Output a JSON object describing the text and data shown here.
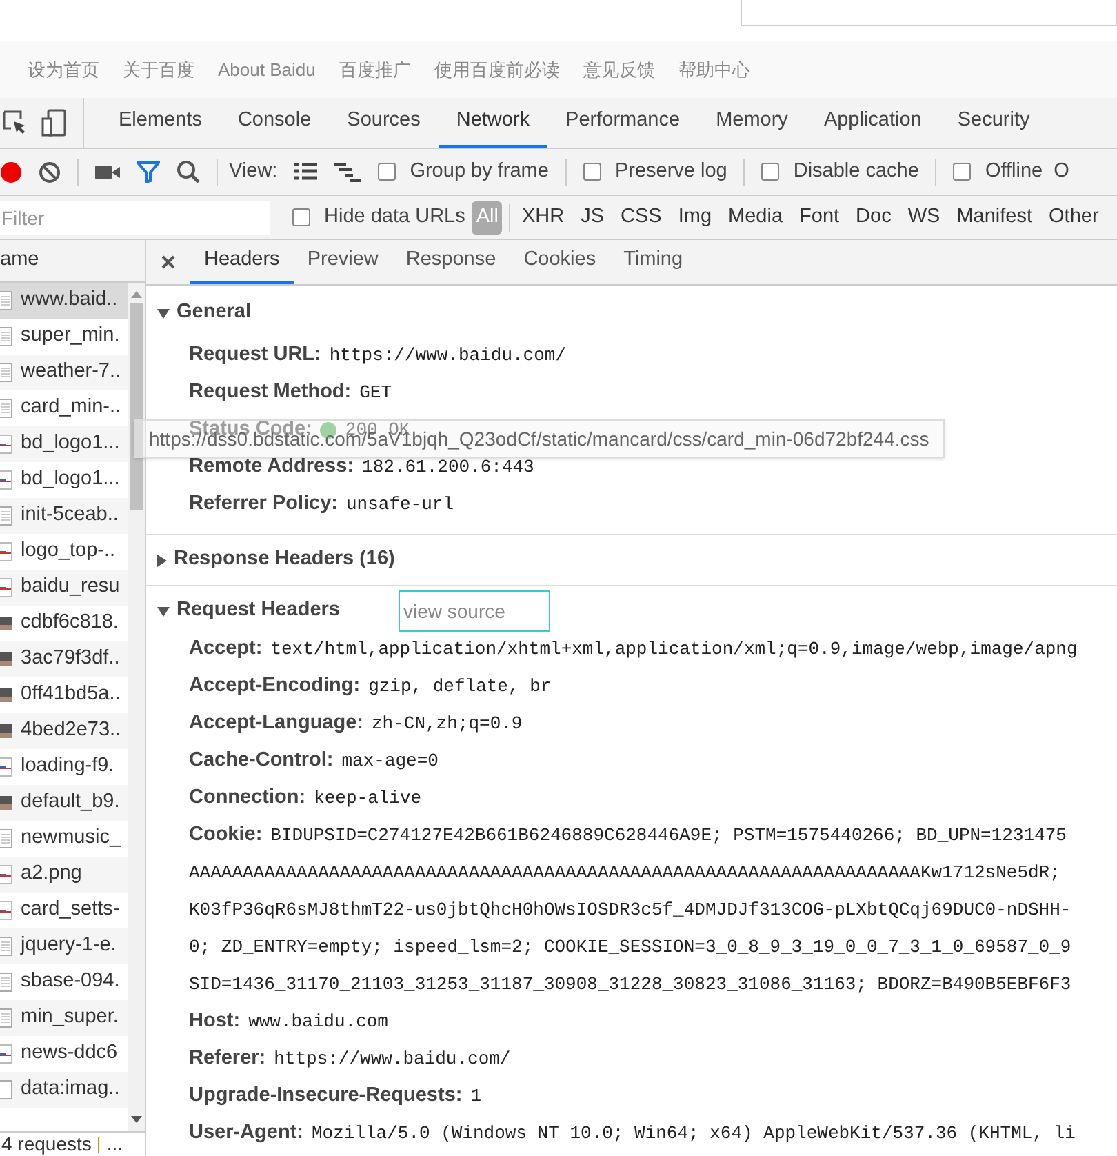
{
  "page_links": [
    "设为首页",
    "关于百度",
    "About Baidu",
    "百度推广",
    "使用百度前必读",
    "意见反馈",
    "帮助中心"
  ],
  "devtools_tabs": [
    {
      "label": "Elements",
      "selected": false
    },
    {
      "label": "Console",
      "selected": false
    },
    {
      "label": "Sources",
      "selected": false
    },
    {
      "label": "Network",
      "selected": true
    },
    {
      "label": "Performance",
      "selected": false
    },
    {
      "label": "Memory",
      "selected": false
    },
    {
      "label": "Application",
      "selected": false
    },
    {
      "label": "Security",
      "selected": false
    }
  ],
  "toolbar": {
    "recording": true,
    "filter_active": true,
    "view_label": "View:",
    "options": [
      {
        "label": "Group by frame",
        "checked": false
      },
      {
        "label": "Preserve log",
        "checked": false
      },
      {
        "label": "Disable cache",
        "checked": false
      },
      {
        "label": "Offline",
        "checked": false
      }
    ],
    "cut_label": "O"
  },
  "filter_bar": {
    "placeholder": "Filter",
    "hide_data_urls": {
      "label": "Hide data URLs",
      "checked": false
    },
    "types": [
      {
        "label": "All",
        "selected": true
      },
      {
        "label": "XHR",
        "selected": false
      },
      {
        "label": "JS",
        "selected": false
      },
      {
        "label": "CSS",
        "selected": false
      },
      {
        "label": "Img",
        "selected": false
      },
      {
        "label": "Media",
        "selected": false
      },
      {
        "label": "Font",
        "selected": false
      },
      {
        "label": "Doc",
        "selected": false
      },
      {
        "label": "WS",
        "selected": false
      },
      {
        "label": "Manifest",
        "selected": false
      },
      {
        "label": "Other",
        "selected": false
      }
    ]
  },
  "requests": {
    "column": "ame",
    "items": [
      {
        "name": "www.baid..",
        "kind": "doc",
        "selected": true
      },
      {
        "name": "super_min.",
        "kind": "doc",
        "selected": false
      },
      {
        "name": "weather-7..",
        "kind": "doc",
        "selected": false
      },
      {
        "name": "card_min-..",
        "kind": "doc",
        "selected": false
      },
      {
        "name": "bd_logo1...",
        "kind": "image",
        "selected": false
      },
      {
        "name": "bd_logo1...",
        "kind": "image",
        "selected": false
      },
      {
        "name": "init-5ceab..",
        "kind": "doc",
        "selected": false
      },
      {
        "name": "logo_top-..",
        "kind": "image",
        "selected": false
      },
      {
        "name": "baidu_resu",
        "kind": "image",
        "selected": false
      },
      {
        "name": "cdbf6c818.",
        "kind": "photo",
        "selected": false
      },
      {
        "name": "3ac79f3df..",
        "kind": "photo",
        "selected": false
      },
      {
        "name": "0ff41bd5a..",
        "kind": "photo",
        "selected": false
      },
      {
        "name": "4bed2e73..",
        "kind": "photo",
        "selected": false
      },
      {
        "name": "loading-f9.",
        "kind": "image",
        "selected": false
      },
      {
        "name": "default_b9.",
        "kind": "photo",
        "selected": false
      },
      {
        "name": "newmusic_",
        "kind": "doc",
        "selected": false
      },
      {
        "name": "a2.png",
        "kind": "image",
        "selected": false
      },
      {
        "name": "card_setts-",
        "kind": "image",
        "selected": false
      },
      {
        "name": "jquery-1-e.",
        "kind": "doc",
        "selected": false
      },
      {
        "name": "sbase-094.",
        "kind": "doc",
        "selected": false
      },
      {
        "name": "min_super.",
        "kind": "doc",
        "selected": false
      },
      {
        "name": "news-ddc6",
        "kind": "image",
        "selected": false
      },
      {
        "name": "data:imag..",
        "kind": "blank",
        "selected": false
      }
    ],
    "status": "4 requests",
    "status_more": "..."
  },
  "detail_tabs": [
    {
      "label": "Headers",
      "selected": true
    },
    {
      "label": "Preview",
      "selected": false
    },
    {
      "label": "Response",
      "selected": false
    },
    {
      "label": "Cookies",
      "selected": false
    },
    {
      "label": "Timing",
      "selected": false
    }
  ],
  "sections": [
    {
      "title": "General",
      "expanded": true,
      "rows": [
        {
          "name": "Request URL:",
          "value": "https://www.baidu.com/"
        },
        {
          "name": "Request Method:",
          "value": "GET"
        },
        {
          "name": "Status Code:",
          "value": "200 OK",
          "indicator": true
        },
        {
          "name": "Remote Address:",
          "value": "182.61.200.6:443"
        },
        {
          "name": "Referrer Policy:",
          "value": "unsafe-url"
        }
      ]
    },
    {
      "title": "Response Headers (16)",
      "expanded": false
    },
    {
      "title": "Request Headers",
      "expanded": true,
      "link": "view source",
      "rows": [
        {
          "name": "Accept:",
          "value": "text/html,application/xhtml+xml,application/xml;q=0.9,image/webp,image/apng"
        },
        {
          "name": "Accept-Encoding:",
          "value": "gzip, deflate, br"
        },
        {
          "name": "Accept-Language:",
          "value": "zh-CN,zh;q=0.9"
        },
        {
          "name": "Cache-Control:",
          "value": "max-age=0"
        },
        {
          "name": "Connection:",
          "value": "keep-alive"
        },
        {
          "name": "Cookie:",
          "value": "BIDUPSID=C274127E42B661B6246889C628446A9E; PSTM=1575440266; BD_UPN=1231475",
          "more": [
            "AAAAAAAAAAAAAAAAAAAAAAAAAAAAAAAAAAAAAAAAAAAAAAAAAAAAAAAAAAAAAAAAAAAAKw1712sNe5dR;",
            "K03fP36qR6sMJ8thmT22-us0jbtQhcH0hOWsIOSDR3c5f_4DMJDJf313COG-pLXbtQCqj69DUC0-nDSHH-",
            "0; ZD_ENTRY=empty; ispeed_lsm=2; COOKIE_SESSION=3_0_8_9_3_19_0_0_7_3_1_0_69587_0_9",
            "SID=1436_31170_21103_31253_31187_30908_31228_30823_31086_31163; BDORZ=B490B5EBF6F3"
          ]
        },
        {
          "name": "Host:",
          "value": "www.baidu.com"
        },
        {
          "name": "Referer:",
          "value": "https://www.baidu.com/"
        },
        {
          "name": "Upgrade-Insecure-Requests:",
          "value": "1"
        },
        {
          "name": "User-Agent:",
          "value": "Mozilla/5.0 (Windows NT 10.0; Win64; x64) AppleWebKit/537.36 (KHTML, li"
        }
      ]
    }
  ],
  "tooltip": "https://dss0.bdstatic.com/5aV1bjqh_Q23odCf/static/mancard/css/card_min-06d72bf244.css"
}
